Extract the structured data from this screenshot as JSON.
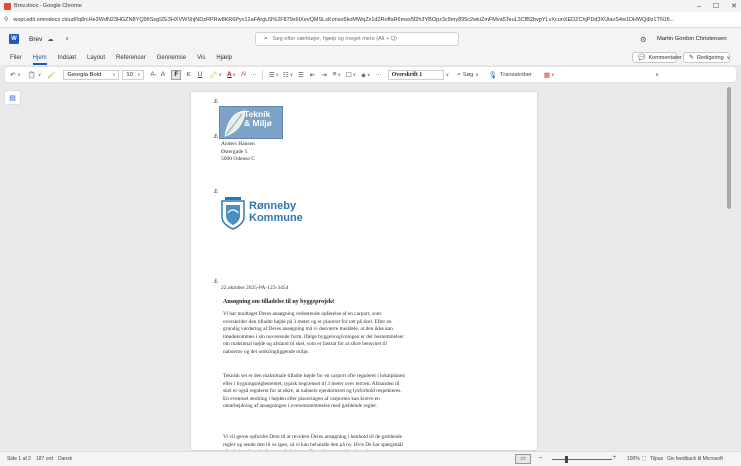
{
  "browser": {
    "title": "Brev.docx - Google Chrome",
    "url": "wopi.edit.omnidocs.cloud/Iq8rcHe3WdN23HGZN8YQ96SsgIZE3HXVWShjNDzRPRw8KR6Pyx12aFArgU9%2F879x6tXevQMSLsKonso5koMWqZs1d2RoffaR6mss5f2h3YBOpz3c9my895c2wkiZmFMva5TeuL3CfB2bvpYLvXcunXEDZChjPDd3XUlavS4w1DHWQdlz1TN1fi..."
  },
  "app": {
    "doc_name": "Brev",
    "search_placeholder": "Søg efter værktøjer, hjælp og meget mere (Alt + Q)",
    "user_name": "Martin Gordon Christensen",
    "tabs": [
      "Filer",
      "Hjem",
      "Indsæt",
      "Layout",
      "Referencer",
      "Gennemse",
      "Vis",
      "Hjælp"
    ],
    "comments_label": "Kommentarer",
    "editing_label": "Redigering"
  },
  "ribbon": {
    "font_name": "Georgia Bold",
    "font_size": "10",
    "style": "Overskrift 1",
    "search_label": "Søg",
    "transcribe_label": "Transskriber",
    "bold": "F",
    "italic": "K",
    "underline": "U"
  },
  "document": {
    "logo1_line1": "Teknik",
    "logo1_line2": "& Miljø",
    "address": [
      "Anders Hansen",
      "Østergade 5",
      "5000 Odense C"
    ],
    "logo2_line1": "Rønneby",
    "logo2_line2": "Kommune",
    "date_ref": "22.oktober 2025-PA-123-3454",
    "heading": "Ansøgning om tilladelse til ny byggeprojekt",
    "paragraphs": [
      "Vi har modtaget Deres ansøgning vedrørende opførelse af en carport, som overskrider den tilladte højde på 3 meter og er placeret for tæt på skel. Efter en grundig vurdering af Deres ansøgning må vi desværre meddele, at den ikke kan imødekommes i sin nuværende form. Ifølge byggelovgivningen er der bestemmelser om maksimal højde og afstand til skel, som er fastsat for at sikre hensynet til naboerne og det omkringliggende miljø.",
      "Teknisk set er den maksimale tilladte højde for en carport ofte reguleret i lokalplanen eller i bygningsreglementet, typisk begrænset til 3 meter over terræn. Afstanden til skel er også reguleret for at sikre, at naboers ejendomsret og lysforhold respekteres. En eventuel ændring i højden eller placeringen af carporten kan kræve en omarbejdning af ansøgningen i overensstemmelse med gældende regler.",
      "Vi vil gerne opfordre Dem til at revidere Deres ansøgning i henhold til de gældende regler og sende den til os igen, så vi kan behandle den på ny. Hvis De har spørgsmål eller behov for yderligere vejledning, er De velkommen til at kontakte os."
    ]
  },
  "status": {
    "page_info": "Side 1 af 2",
    "word_count": "187 ord",
    "language": "Dansk",
    "zoom": "100%",
    "fit_label": "Tilpas",
    "feedback": "Giv feedback til Microsoft"
  }
}
